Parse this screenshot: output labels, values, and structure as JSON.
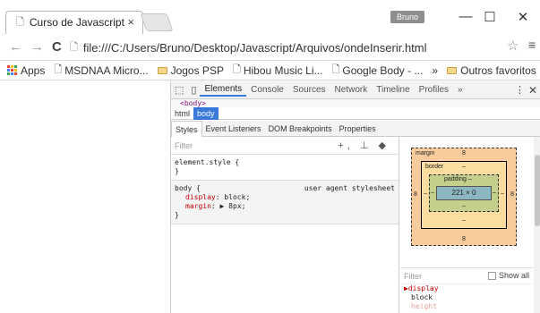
{
  "window": {
    "tab_title": "Curso de Javascript",
    "tab_close": "×",
    "user_name": "Bruno",
    "minimize": "—",
    "maximize": "☐",
    "close": "✕"
  },
  "toolbar": {
    "back": "←",
    "forward": "→",
    "reload": "C",
    "url": "file:///C:/Users/Bruno/Desktop/Javascript/Arquivos/ondeInserir.html",
    "star": "☆",
    "menu": "≡"
  },
  "bookmarks": {
    "apps": "Apps",
    "items": [
      "MSDNAA Micro...",
      "Jogos PSP",
      "Hibou Music Li...",
      "Google Body - ..."
    ],
    "overflow": "»",
    "other": "Outros favoritos"
  },
  "devtools": {
    "tabs": [
      "Elements",
      "Console",
      "Sources",
      "Network",
      "Timeline",
      "Profiles"
    ],
    "more_tabs": "»",
    "kebab": "⋮",
    "close": "✕",
    "elem_line": "<body>",
    "breadcrumbs": [
      "html",
      "body"
    ],
    "subtabs": [
      "Styles",
      "Event Listeners",
      "DOM Breakpoints",
      "Properties"
    ],
    "filter_placeholder": "Filter",
    "filter_tools": "+, ⊥ ◆",
    "rule1": {
      "selector": "element.style {",
      "close": "}"
    },
    "rule2": {
      "selector": "body {",
      "source": "user agent stylesheet",
      "p1_name": "display",
      "p1_value": "block;",
      "p2_name": "margin",
      "p2_value": "▶ 8px;",
      "close": "}"
    },
    "box": {
      "margin_label": "margin",
      "margin_top": "8",
      "margin_left": "8",
      "margin_right": "8",
      "margin_bottom": "8",
      "border_label": "border",
      "border_top": "–",
      "border_left": "–",
      "border_right": "–",
      "border_bottom": "–",
      "padding_label": "padding –",
      "padding_left": "–",
      "padding_right": "–",
      "padding_bottom": "–",
      "content": "221 × 0"
    },
    "computed": {
      "filter_placeholder": "Filter",
      "show_all": "Show all",
      "prop1": "▶display",
      "val1": "block",
      "prop2": "height"
    }
  },
  "colors": {
    "accent": "#3879d9",
    "margin": "#f9cc9d",
    "border": "#fbdda0",
    "padding": "#c3cf8a",
    "content": "#8cb6c0"
  }
}
